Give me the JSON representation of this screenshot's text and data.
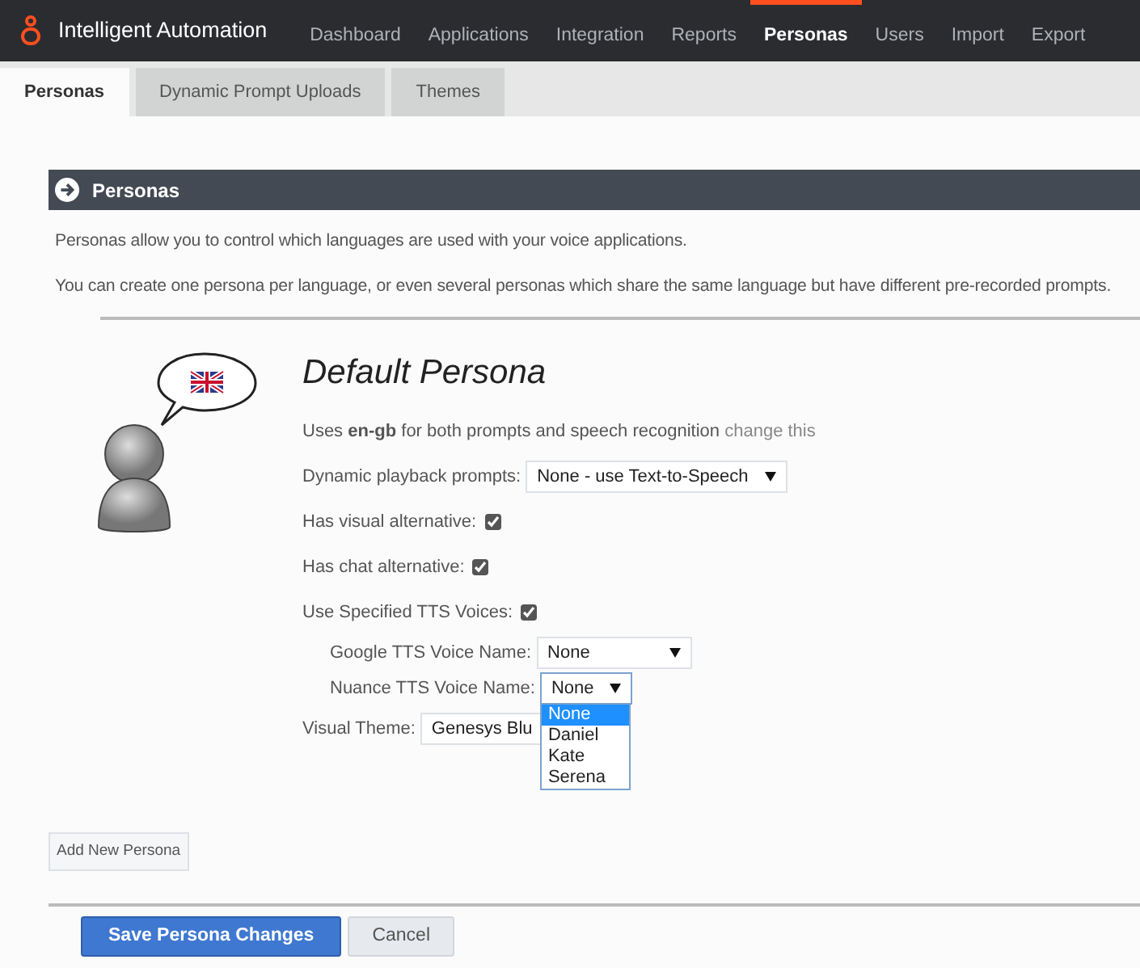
{
  "app": {
    "title": "Intelligent Automation"
  },
  "nav": [
    {
      "label": "Dashboard",
      "selected": false
    },
    {
      "label": "Applications",
      "selected": false
    },
    {
      "label": "Integration",
      "selected": false
    },
    {
      "label": "Reports",
      "selected": false
    },
    {
      "label": "Personas",
      "selected": true
    },
    {
      "label": "Users",
      "selected": false
    },
    {
      "label": "Import",
      "selected": false
    },
    {
      "label": "Export",
      "selected": false
    }
  ],
  "tabs": [
    {
      "label": "Personas",
      "selected": true
    },
    {
      "label": "Dynamic Prompt Uploads",
      "selected": false
    },
    {
      "label": "Themes",
      "selected": false
    }
  ],
  "section": {
    "title": "Personas",
    "paragraphs": [
      "Personas allow you to control which languages are used with your voice applications.",
      "You can create one persona per language, or even several personas which share the same language but have different pre-recorded prompts."
    ]
  },
  "persona": {
    "title": "Default Persona",
    "language_line": "Uses **en-gb** for both prompts and speech recognition",
    "change_link": "change this",
    "fields": [
      {
        "kind": "select",
        "label": "Dynamic playback prompts:",
        "value": "None - use Text-to-Speech",
        "indent": false,
        "expanded": false
      },
      {
        "kind": "checkbox",
        "label": "Has visual alternative:",
        "checked": true
      },
      {
        "kind": "checkbox",
        "label": "Has chat alternative:",
        "checked": true
      },
      {
        "kind": "checkbox",
        "label": "Use Specified TTS Voices:",
        "checked": true
      },
      {
        "kind": "select",
        "label": "Google TTS Voice Name:",
        "value": "None",
        "indent": true,
        "expanded": false
      },
      {
        "kind": "select",
        "label": "Nuance TTS Voice Name:",
        "value": "None",
        "indent": true,
        "expanded": true,
        "options": [
          {
            "label": "None",
            "selected": true
          },
          {
            "label": "Daniel",
            "selected": false
          },
          {
            "label": "Kate",
            "selected": false
          },
          {
            "label": "Serena",
            "selected": false
          }
        ]
      },
      {
        "kind": "select",
        "label": "Visual Theme:",
        "value": "Genesys Blu",
        "indent": false,
        "expanded": false
      }
    ]
  },
  "add_button": "Add New Persona",
  "save_button": "Save Persona Changes",
  "cancel_button": "Cancel"
}
